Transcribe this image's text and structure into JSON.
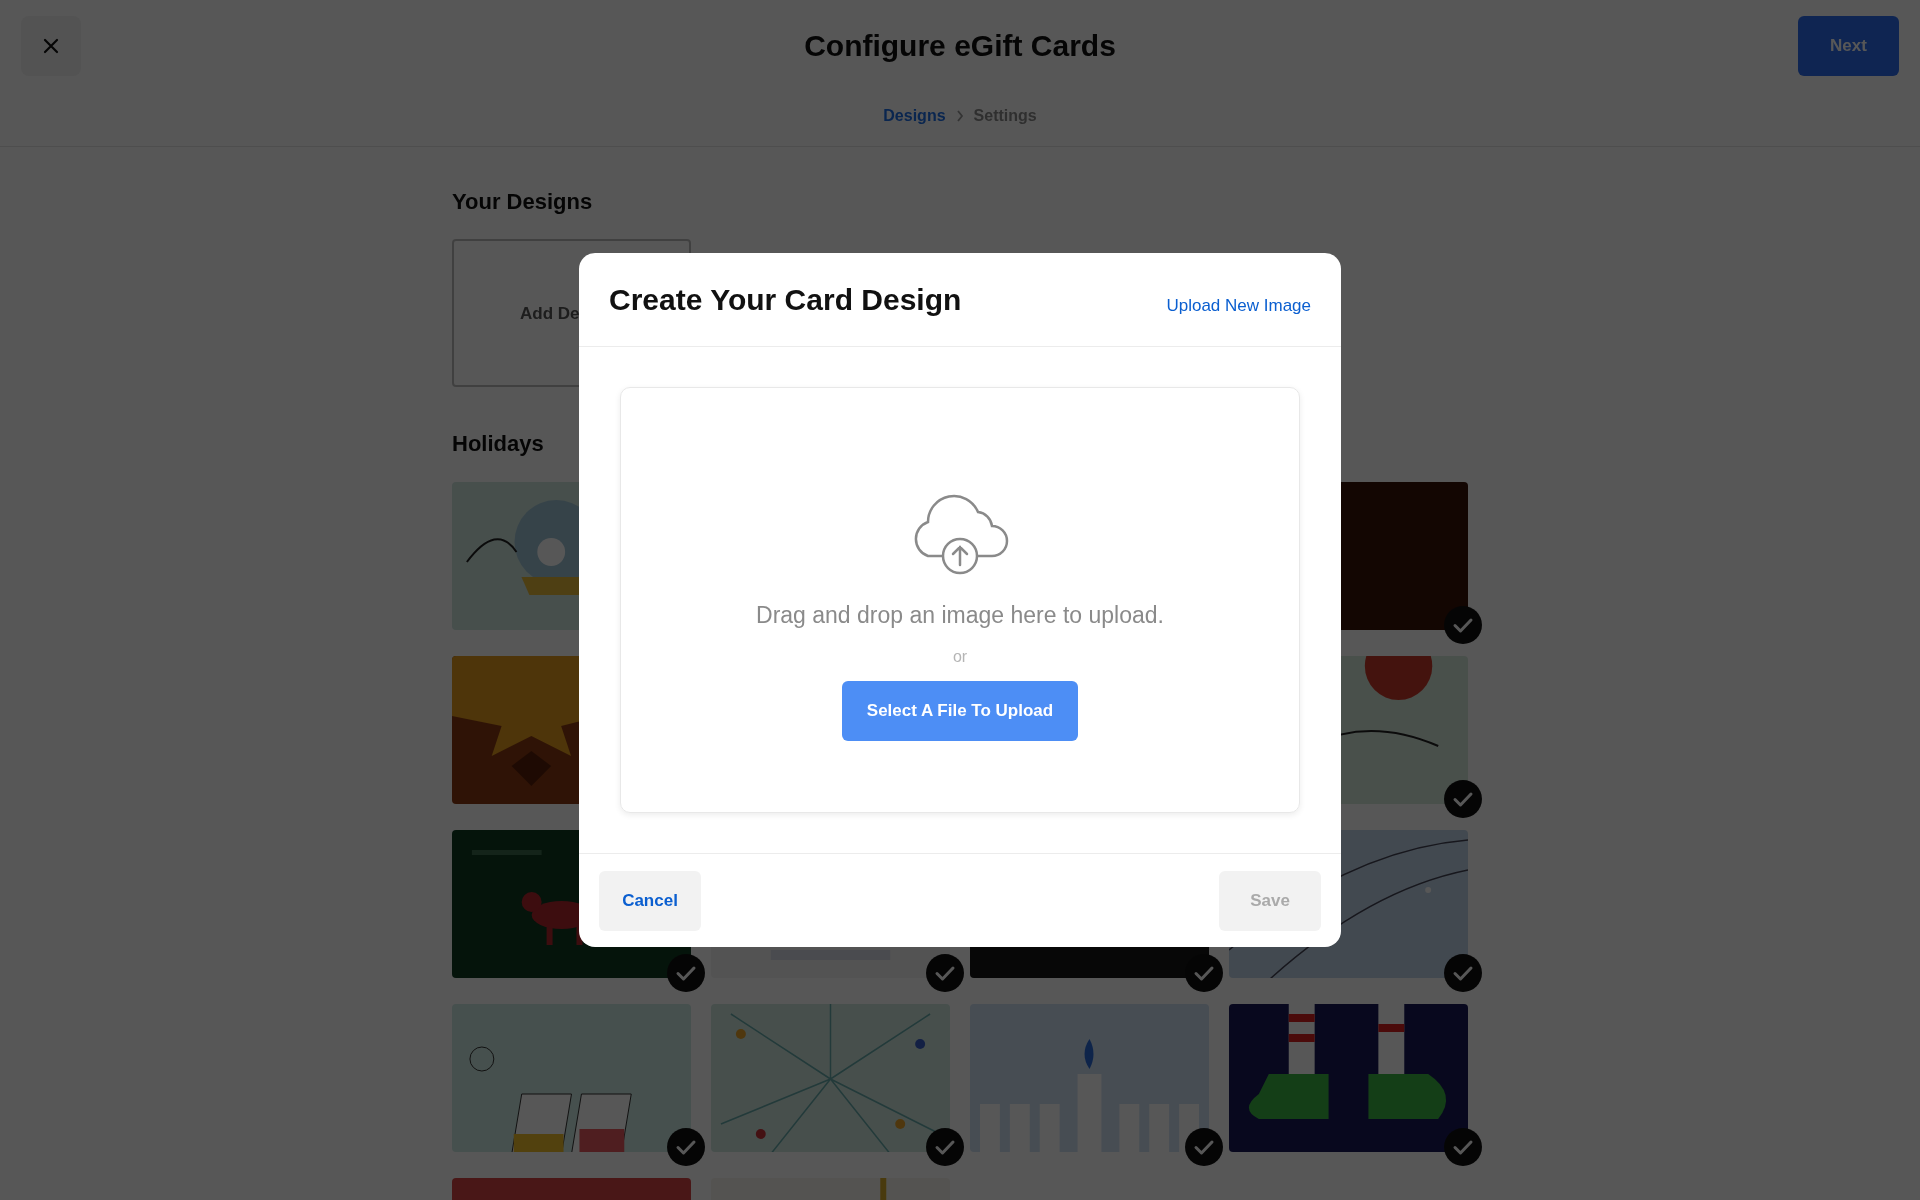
{
  "header": {
    "title": "Configure eGift Cards",
    "next_button": "Next"
  },
  "breadcrumbs": [
    {
      "label": "Designs",
      "selected": true
    },
    {
      "label": "Settings",
      "selected": false
    }
  ],
  "your_designs": {
    "heading": "Your Designs",
    "add_tile": "Add De"
  },
  "holidays": {
    "heading": "Holidays",
    "rows": [
      {
        "kind": "split",
        "cards": [
          {
            "kind": "snowglobe"
          },
          {
            "kind": "pumpkin",
            "selected": true
          }
        ]
      },
      {
        "kind": "split",
        "cards": [
          {
            "kind": "leaf"
          },
          {
            "kind": "christmas",
            "selected": true
          }
        ]
      },
      {
        "kind": "full",
        "cards": [
          {
            "kind": "dachshund",
            "selected": true
          },
          {
            "kind": "greetings",
            "selected": true
          },
          {
            "kind": "dark",
            "selected": true
          },
          {
            "kind": "giftcard",
            "selected": true
          }
        ]
      },
      {
        "kind": "full",
        "cards": [
          {
            "kind": "glasses",
            "selected": true
          },
          {
            "kind": "burst",
            "selected": true
          },
          {
            "kind": "hanukkah",
            "selected": true
          },
          {
            "kind": "elf",
            "selected": true
          }
        ]
      },
      {
        "kind": "full",
        "cards": [
          {
            "kind": "red"
          },
          {
            "kind": "gold"
          }
        ]
      }
    ]
  },
  "dialog": {
    "title": "Create Your Card Design",
    "upload_link": "Upload New Image",
    "prompt": "Drag and drop an image here to upload.",
    "separator": "or",
    "select_button": "Select A File To Upload",
    "cancel_button": "Cancel",
    "save_button": {
      "label": "Save",
      "disabled": true
    }
  }
}
